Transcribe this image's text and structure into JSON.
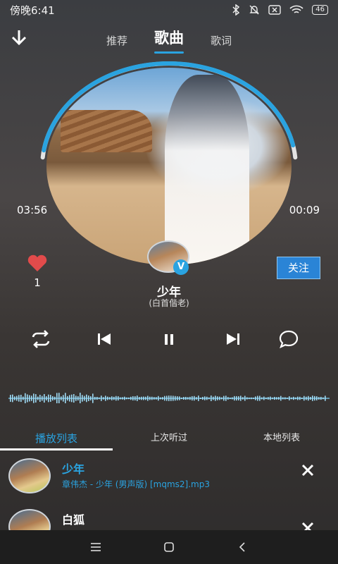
{
  "status": {
    "time": "傍晚6:41",
    "battery": "46"
  },
  "nav": {
    "tabs": [
      {
        "label": "推荐"
      },
      {
        "label": "歌曲"
      },
      {
        "label": "歌词"
      }
    ]
  },
  "player": {
    "elapsed": "03:56",
    "remaining": "00:09",
    "progress": 0.96,
    "like_count": "1",
    "follow_label": "关注",
    "vip_badge": "V",
    "song_title": "少年",
    "song_artist": "(白首偕老)"
  },
  "list_tabs": [
    {
      "label": "播放列表"
    },
    {
      "label": "上次听过"
    },
    {
      "label": "本地列表"
    }
  ],
  "tracks": [
    {
      "title": "少年",
      "subtitle": "章伟杰 - 少年 (男声版) [mqms2].mp3"
    },
    {
      "title": "白狐",
      "subtitle": ""
    }
  ],
  "colors": {
    "accent": "#2aa3e0",
    "like": "#e24b4b",
    "follow_bg": "#2a84d6"
  }
}
